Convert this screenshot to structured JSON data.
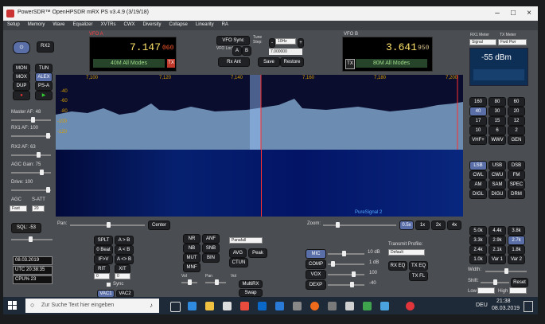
{
  "window": {
    "title": "PowerSDR™ OpenHPSDR mRX PS v3.4.9 (3/19/18)"
  },
  "menu": [
    "Setup",
    "Memory",
    "Wave",
    "Equalizer",
    "XVTRs",
    "CWX",
    "Diversity",
    "Collapse",
    "Linearity",
    "RA"
  ],
  "vfo_a": {
    "label": "VFO A",
    "freq": "7.147",
    "freq_sub": "060",
    "mode": "40M All Modes",
    "tx": "TX"
  },
  "vfo_b": {
    "label": "VFO B",
    "freq": "3.641",
    "freq_sub": "950",
    "mode": "80M All Modes",
    "tx": "TX"
  },
  "vfo_controls": {
    "vfo_sync": "VFO Sync",
    "vfo_lock": "VFO Lock",
    "a": "A",
    "b": "B",
    "rx_ant": "Rx Ant",
    "tune_step": "Tune Step:",
    "step": "10Hz",
    "step_freq": "7.000000",
    "save": "Save",
    "restore": "Restore",
    "minus": "-",
    "plus": "+"
  },
  "meters": {
    "rx1_label": "RX1 Meter",
    "tx_label": "TX Meter",
    "rx_sel": "Signal",
    "tx_sel": "Fwd Pwr",
    "reading": "-55 dBm"
  },
  "left": {
    "rx2": "RX2",
    "mon": "MON",
    "tun": "TUN",
    "mox": "MOX",
    "alex": "ALEX",
    "dup": "DUP",
    "psa": "PS-A",
    "master_af": "Master AF: 48",
    "rx1_af": "RX1 AF: 100",
    "rx2_af": "RX2 AF: 63",
    "agc_gain": "AGC Gain: 75",
    "drive": "Drive: 100",
    "agc": "AGC",
    "satt": "S-ATT",
    "agc_mode": "Fast",
    "satt_val": "20",
    "sql": "SQL: -53",
    "date": "08.03.2019",
    "utc": "UTC 20:38:35",
    "cpu": "CPU% 23"
  },
  "spectrum": {
    "ticks": [
      "7,100",
      "7,120",
      "7,140",
      "7,160",
      "7,180",
      "7,200"
    ],
    "db_labels": [
      "-40",
      "-60",
      "-80",
      "-100",
      "-120"
    ],
    "puresignal": "PureSignal 2"
  },
  "bands": [
    "160",
    "80",
    "60",
    "40",
    "30",
    "20",
    "17",
    "15",
    "12",
    "10",
    "6",
    "2",
    "VHF+",
    "WWV",
    "GEN"
  ],
  "modes": [
    "LSB",
    "USB",
    "DSB",
    "CWL",
    "CWU",
    "FM",
    "AM",
    "SAM",
    "SPEC",
    "DIGL",
    "DIGU",
    "DRM"
  ],
  "filters": [
    "5.0k",
    "4.4k",
    "3.8k",
    "3.3k",
    "2.9k",
    "2.7k",
    "2.4k",
    "2.1k",
    "1.8k",
    "1.0k",
    "Var 1",
    "Var 2"
  ],
  "lower": {
    "pan": "Pan:",
    "center": "Center",
    "zoom": "Zoom:",
    "zooms": [
      "0.5x",
      "1x",
      "2x",
      "4x"
    ],
    "splt": "SPLT",
    "a_to_b": "A > B",
    "zero_beat": "0 Beat",
    "b_to_a": "A < B",
    "if_vfo": "IF>V",
    "swap": "A <> B",
    "rit": "RIT",
    "xit": "XIT",
    "rit_val": "0",
    "xit_val": "0",
    "sync": "Sync",
    "vac1": "VAC1",
    "vac2": "VAC2",
    "nr": "NR",
    "anf": "ANF",
    "nb": "NB",
    "snb": "SNB",
    "mut": "MUT",
    "bin": "BIN",
    "mnf": "MNF",
    "display_mode": "Panafall",
    "avg": "AVG",
    "peak": "Peak",
    "ctun": "CTUN",
    "vol": "Vol",
    "pan2": "Pan",
    "vol2": "Vol",
    "multirx": "MultiRX",
    "swap_btn": "Swap",
    "mic": "MIC",
    "mic_val": "10 dB",
    "comp": "COMP",
    "comp_val": "1 dB",
    "vox": "VOX",
    "vox_val": "100",
    "dexp": "DEXP",
    "dexp_val": "-40",
    "tx_profile": "Transmit Profile:",
    "profile": "Default",
    "rx_eq": "RX EQ",
    "tx_eq": "TX EQ",
    "tx_fl": "TX FL",
    "width": "Width:",
    "shift": "Shift:",
    "reset": "Reset",
    "low": "Low",
    "high": "High",
    "low_val": "",
    "high_val": ""
  },
  "taskbar": {
    "search_placeholder": "Zur Suche Text hier eingeben",
    "lang": "DEU",
    "time": "21:38",
    "date": "08.03.2019"
  }
}
